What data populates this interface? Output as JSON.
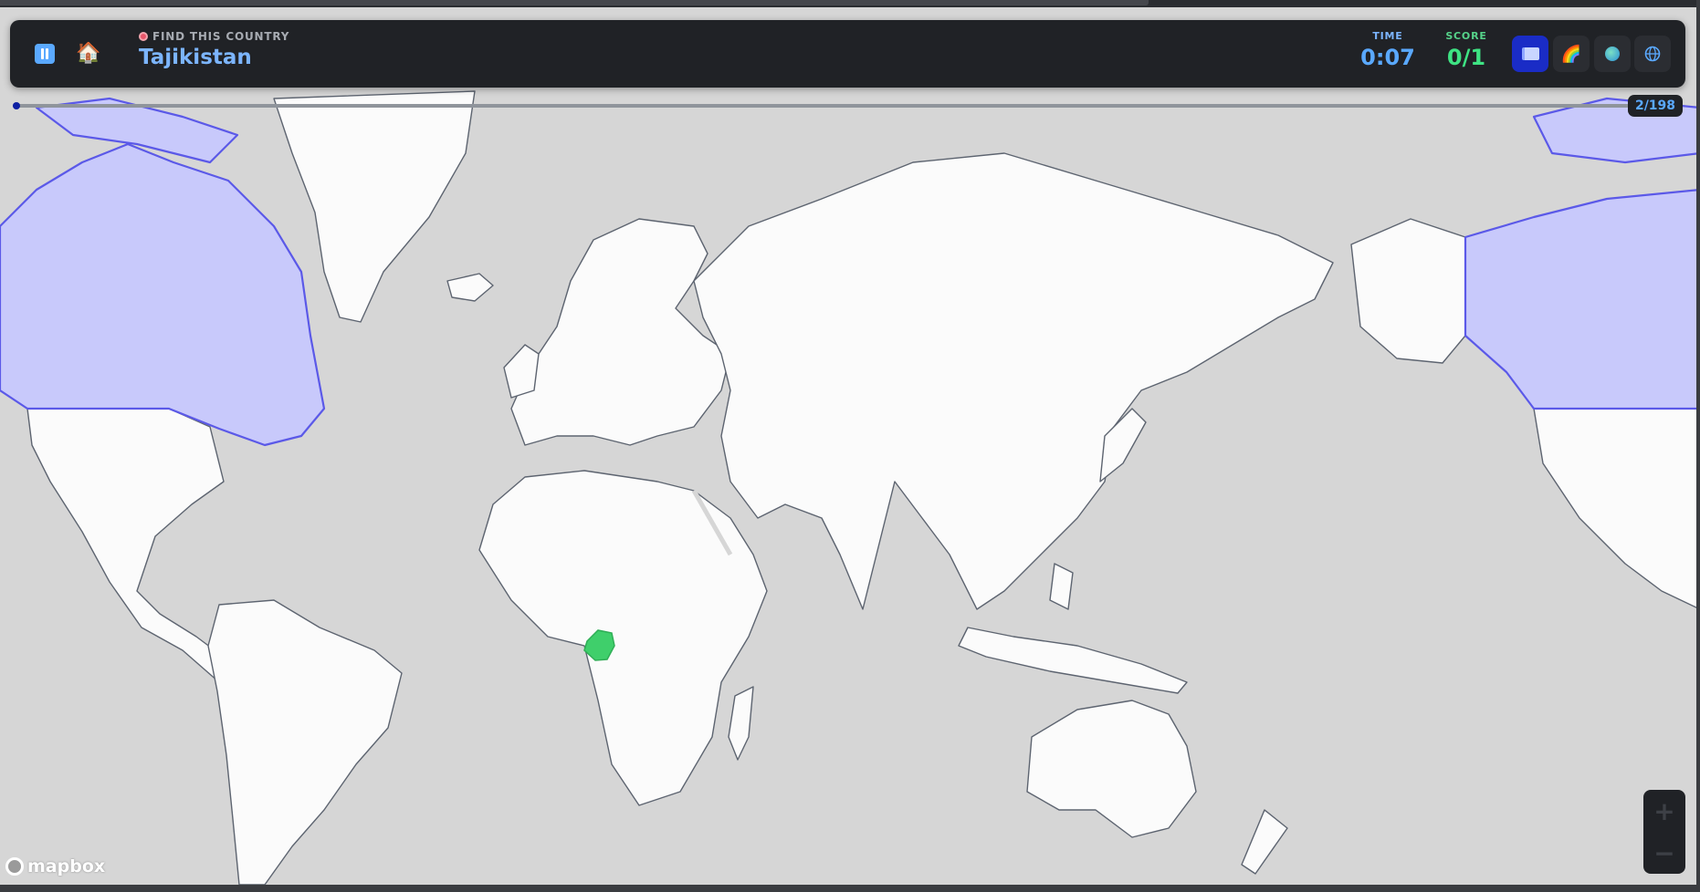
{
  "header": {
    "prompt_label": "FIND THIS COUNTRY",
    "target_country": "Tajikistan",
    "time_label": "TIME",
    "time_value": "0:07",
    "score_label": "SCORE",
    "score_value": "0/1"
  },
  "icons": {
    "pause": "pause-icon",
    "home": "house-icon",
    "modes": [
      "book-icon",
      "rainbow-icon",
      "earth-icon",
      "globe-grid-icon"
    ]
  },
  "progress": {
    "label": "2/198",
    "current": 2,
    "total": 198
  },
  "map": {
    "highlighted_correct": "Gabon",
    "highlighted_region": "Canada",
    "attribution": "mapbox"
  },
  "colors": {
    "accent": "#5aa9ff",
    "score": "#3ee383",
    "correct_fill": "#3fcf6b",
    "highlight_fill": "#c8c9fb",
    "highlight_stroke": "#5b59e8",
    "land": "#fbfbfb",
    "water": "#d6d6d6",
    "border": "#5d6470"
  }
}
